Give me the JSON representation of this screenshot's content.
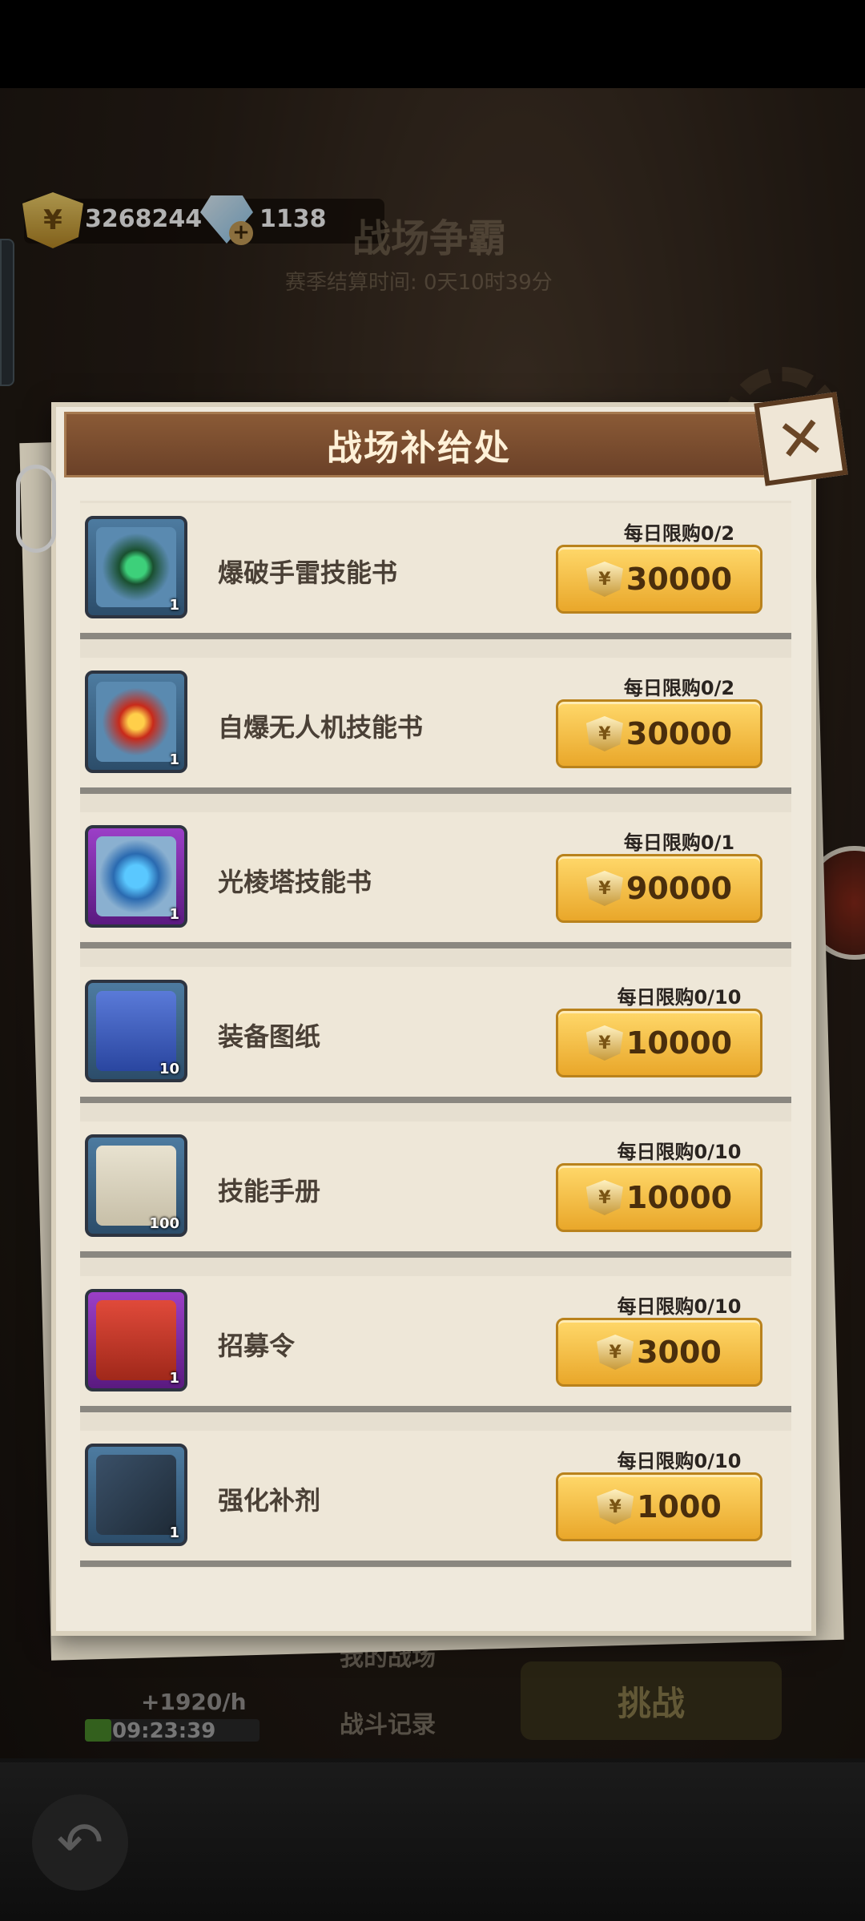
{
  "currency": {
    "gold": "3268244",
    "gems": "1138"
  },
  "background": {
    "title": "战场争霸",
    "season_timer": "赛季结算时间: 0天10时39分",
    "my_battlefield": "我的战场",
    "battle_record": "战斗记录",
    "challenge": "挑战",
    "rate": "+1920/h",
    "timer": "09:23:39",
    "timer_progress": 0.15
  },
  "modal": {
    "title": "战场补给处",
    "items": [
      {
        "name": "爆破手雷技能书",
        "limit": "每日限购0/2",
        "price": "30000",
        "qty": "1",
        "rarity": "blue",
        "icon": "grenade-skill-book-icon"
      },
      {
        "name": "自爆无人机技能书",
        "limit": "每日限购0/2",
        "price": "30000",
        "qty": "1",
        "rarity": "blue",
        "icon": "drone-skill-book-icon"
      },
      {
        "name": "光棱塔技能书",
        "limit": "每日限购0/1",
        "price": "90000",
        "qty": "1",
        "rarity": "purple",
        "icon": "prism-tower-skill-book-icon"
      },
      {
        "name": "装备图纸",
        "limit": "每日限购0/10",
        "price": "10000",
        "qty": "10",
        "rarity": "blue",
        "icon": "blueprint-icon"
      },
      {
        "name": "技能手册",
        "limit": "每日限购0/10",
        "price": "10000",
        "qty": "100",
        "rarity": "blue",
        "icon": "skill-manual-icon"
      },
      {
        "name": "招募令",
        "limit": "每日限购0/10",
        "price": "3000",
        "qty": "1",
        "rarity": "purple",
        "icon": "recruit-order-icon"
      },
      {
        "name": "强化补剂",
        "limit": "每日限购0/10",
        "price": "1000",
        "qty": "1",
        "rarity": "blue",
        "icon": "enhance-syringe-icon"
      }
    ]
  },
  "colors": {
    "buy_button": "#f4c04a",
    "header": "#7a4c2e",
    "panel": "#efe9dc"
  }
}
